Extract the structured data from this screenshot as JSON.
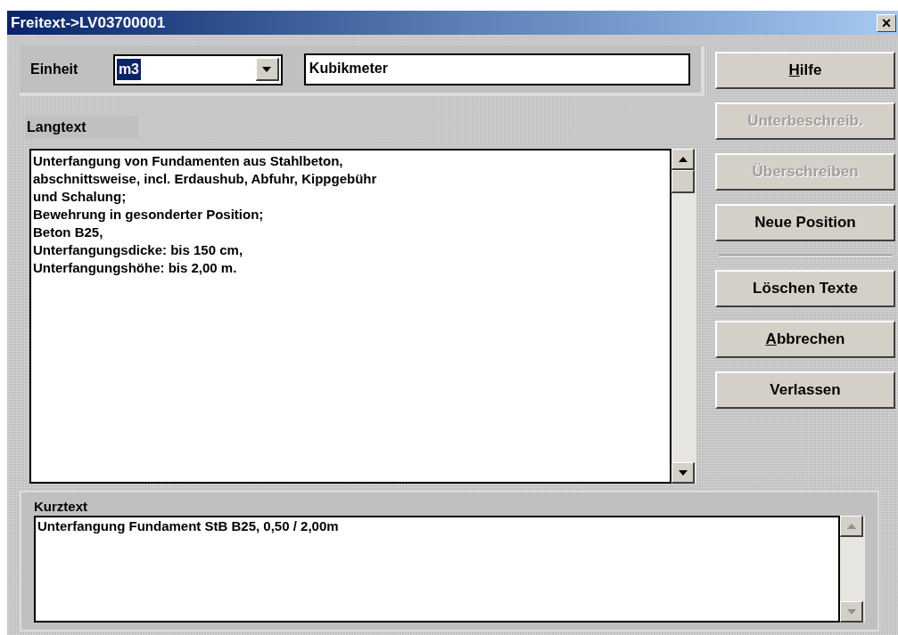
{
  "window": {
    "title": "Freitext->LV03700001",
    "close": "×"
  },
  "unit": {
    "label": "Einheit",
    "value": "m3",
    "selected": true,
    "description": "Kubikmeter"
  },
  "langtext": {
    "label": "Langtext",
    "lines": [
      "Unterfangung von Fundamenten aus Stahlbeton,",
      "abschnittsweise, incl. Erdaushub, Abfuhr, Kippgebühr",
      "und Schalung;",
      "Bewehrung in gesonderter Position;",
      "Beton B25,",
      "Unterfangungsdicke: bis 150 cm,",
      "Unterfangungshöhe: bis 2,00 m."
    ]
  },
  "kurztext": {
    "label": "Kurztext",
    "value": "Unterfangung Fundament StB B25, 0,50 / 2,00m"
  },
  "buttons": [
    {
      "label": "Hilfe",
      "disabled": false,
      "underline_first": true,
      "separator_after": false
    },
    {
      "label": "Unterbeschreib.",
      "disabled": true,
      "underline_first": false,
      "separator_after": false
    },
    {
      "label": "Überschreiben",
      "disabled": true,
      "underline_first": false,
      "separator_after": false
    },
    {
      "label": "Neue Position",
      "disabled": false,
      "underline_first": false,
      "separator_after": true
    },
    {
      "label": "Löschen Texte",
      "disabled": false,
      "underline_first": false,
      "separator_after": false
    },
    {
      "label": "Abbrechen",
      "disabled": false,
      "underline_first": true,
      "separator_after": false
    },
    {
      "label": "Verlassen",
      "disabled": false,
      "underline_first": false,
      "separator_after": false
    }
  ]
}
